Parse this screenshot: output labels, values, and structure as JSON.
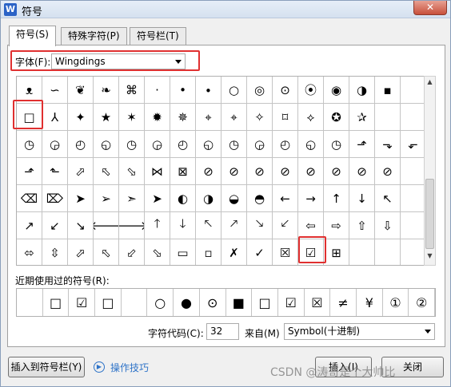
{
  "window": {
    "app_icon": "W",
    "title": "符号",
    "close": "✕"
  },
  "tabs": [
    {
      "label": "符号(S)"
    },
    {
      "label": "特殊字符(P)"
    },
    {
      "label": "符号栏(T)"
    }
  ],
  "font": {
    "label": "字体(F):",
    "value": "Wingdings"
  },
  "symbols": [
    "ᴥ",
    "∽",
    "❦",
    "❧",
    "⌘",
    "·",
    "•",
    "∙",
    "○",
    "◎",
    "⊙",
    "⦿",
    "◉",
    "◑",
    "▪",
    "",
    "□",
    "⅄",
    "✦",
    "★",
    "✶",
    "✹",
    "✵",
    "⌖",
    "⌖",
    "✧",
    "⌑",
    "⟡",
    "✪",
    "✰",
    "",
    "",
    "◷",
    "◶",
    "◴",
    "◵",
    "◷",
    "◶",
    "◴",
    "◵",
    "◷",
    "◶",
    "◴",
    "◵",
    "◷",
    "⬏",
    "⬎",
    "⬐",
    "⬏",
    "⬑",
    "⬀",
    "⬁",
    "⬂",
    "⋈",
    "⊠",
    "⊘",
    "⊘",
    "⊘",
    "⊘",
    "⊘",
    "⊘",
    "⊘",
    "⊘",
    "",
    "⌫",
    "⌦",
    "➤",
    "➢",
    "➣",
    "➤",
    "◐",
    "◑",
    "◒",
    "◓",
    "←",
    "→",
    "↑",
    "↓",
    "↖",
    "",
    "↗",
    "↙",
    "↘",
    "🡐",
    "🡒",
    "🡑",
    "🡓",
    "🡔",
    "🡕",
    "🡖",
    "🡗",
    "⇦",
    "⇨",
    "⇧",
    "⇩",
    "",
    "⬄",
    "⇳",
    "⬀",
    "⬁",
    "⬃",
    "⬂",
    "▭",
    "▫",
    "✗",
    "✓",
    "☒",
    "☑",
    "⊞",
    "",
    "",
    ""
  ],
  "recent": {
    "label": "近期使用过的符号(R):",
    "items": [
      "",
      "□",
      "☑",
      "□",
      "",
      "○",
      "●",
      "⊙",
      "■",
      "□",
      "☑",
      "☒",
      "≠",
      "¥",
      "①",
      "②"
    ]
  },
  "charcode": {
    "label": "字符代码(C):",
    "value": "32"
  },
  "from": {
    "label": "来自(M)",
    "value": "Symbol(十进制)"
  },
  "buttons": {
    "insert_to_bar": "插入到符号栏(Y)",
    "tips": "操作技巧",
    "insert": "插入(I)",
    "close": "关闭"
  },
  "watermark": "CSDN @涛哥是个大帅比",
  "colors": {
    "highlight": "#e03030",
    "link": "#2e73c8"
  },
  "icons": [
    "app-icon",
    "close-icon",
    "dropdown-arrow-icon",
    "tips-icon",
    "scroll-up-icon",
    "scroll-down-icon"
  ]
}
